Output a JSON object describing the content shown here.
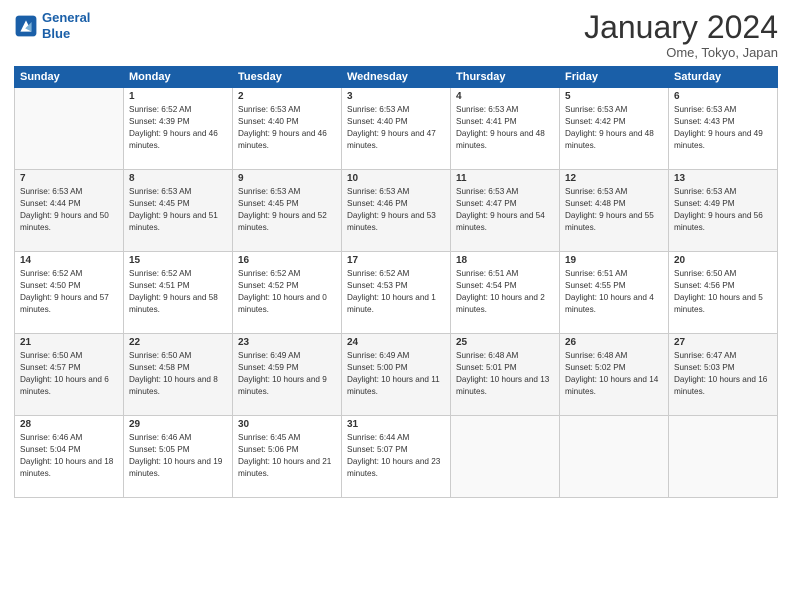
{
  "logo": {
    "line1": "General",
    "line2": "Blue"
  },
  "title": "January 2024",
  "location": "Ome, Tokyo, Japan",
  "header": {
    "days": [
      "Sunday",
      "Monday",
      "Tuesday",
      "Wednesday",
      "Thursday",
      "Friday",
      "Saturday"
    ]
  },
  "weeks": [
    [
      {
        "day": "",
        "sunrise": "",
        "sunset": "",
        "daylight": ""
      },
      {
        "day": "1",
        "sunrise": "Sunrise: 6:52 AM",
        "sunset": "Sunset: 4:39 PM",
        "daylight": "Daylight: 9 hours and 46 minutes."
      },
      {
        "day": "2",
        "sunrise": "Sunrise: 6:53 AM",
        "sunset": "Sunset: 4:40 PM",
        "daylight": "Daylight: 9 hours and 46 minutes."
      },
      {
        "day": "3",
        "sunrise": "Sunrise: 6:53 AM",
        "sunset": "Sunset: 4:40 PM",
        "daylight": "Daylight: 9 hours and 47 minutes."
      },
      {
        "day": "4",
        "sunrise": "Sunrise: 6:53 AM",
        "sunset": "Sunset: 4:41 PM",
        "daylight": "Daylight: 9 hours and 48 minutes."
      },
      {
        "day": "5",
        "sunrise": "Sunrise: 6:53 AM",
        "sunset": "Sunset: 4:42 PM",
        "daylight": "Daylight: 9 hours and 48 minutes."
      },
      {
        "day": "6",
        "sunrise": "Sunrise: 6:53 AM",
        "sunset": "Sunset: 4:43 PM",
        "daylight": "Daylight: 9 hours and 49 minutes."
      }
    ],
    [
      {
        "day": "7",
        "sunrise": "Sunrise: 6:53 AM",
        "sunset": "Sunset: 4:44 PM",
        "daylight": "Daylight: 9 hours and 50 minutes."
      },
      {
        "day": "8",
        "sunrise": "Sunrise: 6:53 AM",
        "sunset": "Sunset: 4:45 PM",
        "daylight": "Daylight: 9 hours and 51 minutes."
      },
      {
        "day": "9",
        "sunrise": "Sunrise: 6:53 AM",
        "sunset": "Sunset: 4:45 PM",
        "daylight": "Daylight: 9 hours and 52 minutes."
      },
      {
        "day": "10",
        "sunrise": "Sunrise: 6:53 AM",
        "sunset": "Sunset: 4:46 PM",
        "daylight": "Daylight: 9 hours and 53 minutes."
      },
      {
        "day": "11",
        "sunrise": "Sunrise: 6:53 AM",
        "sunset": "Sunset: 4:47 PM",
        "daylight": "Daylight: 9 hours and 54 minutes."
      },
      {
        "day": "12",
        "sunrise": "Sunrise: 6:53 AM",
        "sunset": "Sunset: 4:48 PM",
        "daylight": "Daylight: 9 hours and 55 minutes."
      },
      {
        "day": "13",
        "sunrise": "Sunrise: 6:53 AM",
        "sunset": "Sunset: 4:49 PM",
        "daylight": "Daylight: 9 hours and 56 minutes."
      }
    ],
    [
      {
        "day": "14",
        "sunrise": "Sunrise: 6:52 AM",
        "sunset": "Sunset: 4:50 PM",
        "daylight": "Daylight: 9 hours and 57 minutes."
      },
      {
        "day": "15",
        "sunrise": "Sunrise: 6:52 AM",
        "sunset": "Sunset: 4:51 PM",
        "daylight": "Daylight: 9 hours and 58 minutes."
      },
      {
        "day": "16",
        "sunrise": "Sunrise: 6:52 AM",
        "sunset": "Sunset: 4:52 PM",
        "daylight": "Daylight: 10 hours and 0 minutes."
      },
      {
        "day": "17",
        "sunrise": "Sunrise: 6:52 AM",
        "sunset": "Sunset: 4:53 PM",
        "daylight": "Daylight: 10 hours and 1 minute."
      },
      {
        "day": "18",
        "sunrise": "Sunrise: 6:51 AM",
        "sunset": "Sunset: 4:54 PM",
        "daylight": "Daylight: 10 hours and 2 minutes."
      },
      {
        "day": "19",
        "sunrise": "Sunrise: 6:51 AM",
        "sunset": "Sunset: 4:55 PM",
        "daylight": "Daylight: 10 hours and 4 minutes."
      },
      {
        "day": "20",
        "sunrise": "Sunrise: 6:50 AM",
        "sunset": "Sunset: 4:56 PM",
        "daylight": "Daylight: 10 hours and 5 minutes."
      }
    ],
    [
      {
        "day": "21",
        "sunrise": "Sunrise: 6:50 AM",
        "sunset": "Sunset: 4:57 PM",
        "daylight": "Daylight: 10 hours and 6 minutes."
      },
      {
        "day": "22",
        "sunrise": "Sunrise: 6:50 AM",
        "sunset": "Sunset: 4:58 PM",
        "daylight": "Daylight: 10 hours and 8 minutes."
      },
      {
        "day": "23",
        "sunrise": "Sunrise: 6:49 AM",
        "sunset": "Sunset: 4:59 PM",
        "daylight": "Daylight: 10 hours and 9 minutes."
      },
      {
        "day": "24",
        "sunrise": "Sunrise: 6:49 AM",
        "sunset": "Sunset: 5:00 PM",
        "daylight": "Daylight: 10 hours and 11 minutes."
      },
      {
        "day": "25",
        "sunrise": "Sunrise: 6:48 AM",
        "sunset": "Sunset: 5:01 PM",
        "daylight": "Daylight: 10 hours and 13 minutes."
      },
      {
        "day": "26",
        "sunrise": "Sunrise: 6:48 AM",
        "sunset": "Sunset: 5:02 PM",
        "daylight": "Daylight: 10 hours and 14 minutes."
      },
      {
        "day": "27",
        "sunrise": "Sunrise: 6:47 AM",
        "sunset": "Sunset: 5:03 PM",
        "daylight": "Daylight: 10 hours and 16 minutes."
      }
    ],
    [
      {
        "day": "28",
        "sunrise": "Sunrise: 6:46 AM",
        "sunset": "Sunset: 5:04 PM",
        "daylight": "Daylight: 10 hours and 18 minutes."
      },
      {
        "day": "29",
        "sunrise": "Sunrise: 6:46 AM",
        "sunset": "Sunset: 5:05 PM",
        "daylight": "Daylight: 10 hours and 19 minutes."
      },
      {
        "day": "30",
        "sunrise": "Sunrise: 6:45 AM",
        "sunset": "Sunset: 5:06 PM",
        "daylight": "Daylight: 10 hours and 21 minutes."
      },
      {
        "day": "31",
        "sunrise": "Sunrise: 6:44 AM",
        "sunset": "Sunset: 5:07 PM",
        "daylight": "Daylight: 10 hours and 23 minutes."
      },
      {
        "day": "",
        "sunrise": "",
        "sunset": "",
        "daylight": ""
      },
      {
        "day": "",
        "sunrise": "",
        "sunset": "",
        "daylight": ""
      },
      {
        "day": "",
        "sunrise": "",
        "sunset": "",
        "daylight": ""
      }
    ]
  ]
}
